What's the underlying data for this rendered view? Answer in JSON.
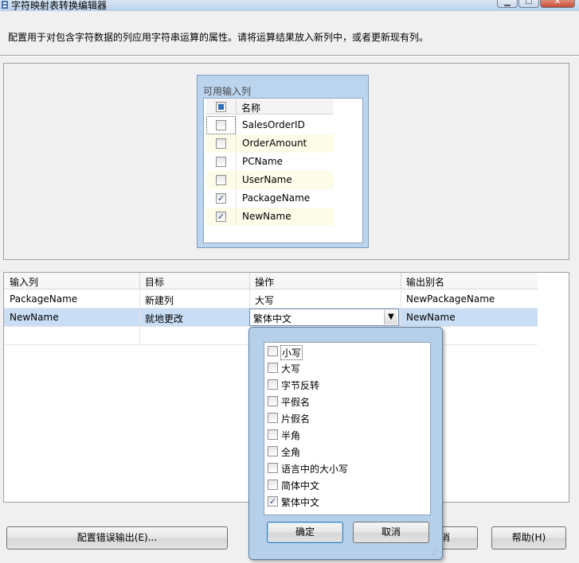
{
  "window": {
    "title": "字符映射表转换编辑器",
    "minimize_label": "▁",
    "maximize_label": "☐",
    "close_label": "✕"
  },
  "description": "配置用于对包含字符数据的列应用字符串运算的属性。请将运算结果放入新列中，或者更新现有列。",
  "available_columns": {
    "title": "可用输入列",
    "header": "名称",
    "items": [
      {
        "name": "SalesOrderID",
        "checked": false
      },
      {
        "name": "OrderAmount",
        "checked": false
      },
      {
        "name": "PCName",
        "checked": false
      },
      {
        "name": "UserName",
        "checked": false
      },
      {
        "name": "PackageName",
        "checked": true
      },
      {
        "name": "NewName",
        "checked": true
      }
    ]
  },
  "grid": {
    "columns": [
      "输入列",
      "目标",
      "操作",
      "输出别名"
    ],
    "rows": [
      {
        "input": "PackageName",
        "target": "新建列",
        "operation": "大写",
        "alias": "NewPackageName"
      },
      {
        "input": "NewName",
        "target": "就地更改",
        "operation": "繁体中文",
        "alias": "NewName"
      }
    ]
  },
  "operation_popup": {
    "options": [
      {
        "label": "小写",
        "checked": false
      },
      {
        "label": "大写",
        "checked": false
      },
      {
        "label": "字节反转",
        "checked": false
      },
      {
        "label": "平假名",
        "checked": false
      },
      {
        "label": "片假名",
        "checked": false
      },
      {
        "label": "半角",
        "checked": false
      },
      {
        "label": "全角",
        "checked": false
      },
      {
        "label": "语言中的大小写",
        "checked": false
      },
      {
        "label": "简体中文",
        "checked": false
      },
      {
        "label": "繁体中文",
        "checked": true
      }
    ],
    "ok_label": "确定",
    "cancel_label": "取消"
  },
  "buttons": {
    "configure_error_output": "配置错误输出(E)...",
    "hidden_cancel_fragment": "消",
    "help": "帮助(H)"
  },
  "colors": {
    "selected_row": "#c9def5",
    "panel_background": "#bcd5ef",
    "popup_background": "#b7d0ea"
  }
}
